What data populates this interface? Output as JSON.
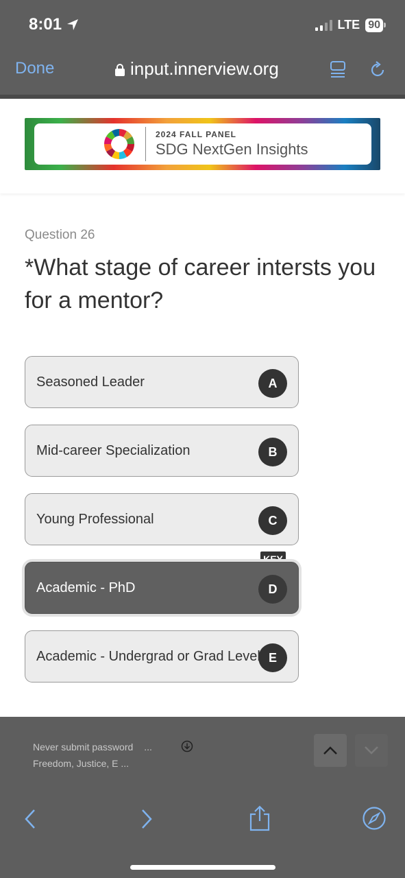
{
  "status_bar": {
    "time": "8:01",
    "network": "LTE",
    "battery": "90"
  },
  "browser": {
    "done_label": "Done",
    "url": "input.innerview.org"
  },
  "banner": {
    "subtitle": "2024 FALL PANEL",
    "title": "SDG NextGen Insights"
  },
  "question": {
    "number_label": "Question 26",
    "text": "*What stage of career intersts you for a mentor?"
  },
  "options": [
    {
      "label": "Seasoned Leader",
      "key": "A",
      "selected": false
    },
    {
      "label": "Mid-career Specialization",
      "key": "B",
      "selected": false
    },
    {
      "label": "Young Professional",
      "key": "C",
      "selected": false
    },
    {
      "label": "Academic - PhD",
      "key": "D",
      "selected": true
    },
    {
      "label": "Academic - Undergrad or Grad Level",
      "key": "E",
      "selected": false
    }
  ],
  "key_badge": "KEY",
  "autofill": {
    "line1": "Never submit password",
    "line1_more": "...",
    "line2": "Freedom, Justice, E ..."
  },
  "colors": {
    "chrome_gray": "#5e5e5e",
    "link_blue": "#7fb3ef",
    "selected_option": "#606060"
  }
}
